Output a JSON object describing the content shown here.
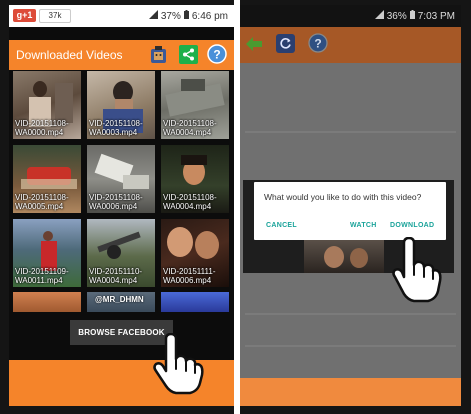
{
  "left_screen": {
    "status": {
      "battery": "37%",
      "time": "6:46 pm"
    },
    "gplus": {
      "label": "g+1",
      "count": "37k"
    },
    "appbar": {
      "title": "Downloaded Videos"
    },
    "videos": [
      {
        "name": "VID-20151108-WA0000.mp4"
      },
      {
        "name": "VID-20151108-WA0003.mp4"
      },
      {
        "name": "VID-20151108-WA0004.mp4"
      },
      {
        "name": "VID-20151108-WA0005.mp4"
      },
      {
        "name": "VID-20151108-WA0006.mp4"
      },
      {
        "name": "VID-20151108-WA0004.mp4"
      },
      {
        "name": "VID-20151109-WA0011.mp4"
      },
      {
        "name": "VID-20151110-WA0004.mp4"
      },
      {
        "name": "VID-20151111-WA0006.mp4"
      }
    ],
    "partial_label": "@MR_DHMN",
    "browse_button": "BROWSE FACEBOOK"
  },
  "right_screen": {
    "status": {
      "battery": "36%",
      "time": "7:03 PM"
    },
    "dialog": {
      "message": "What would you like to do with this video?",
      "cancel": "CANCEL",
      "watch": "WATCH",
      "download": "DOWNLOAD"
    }
  },
  "colors": {
    "orange": "#f5842a",
    "teal": "#1aa39a",
    "dark": "#0c0c0c"
  }
}
